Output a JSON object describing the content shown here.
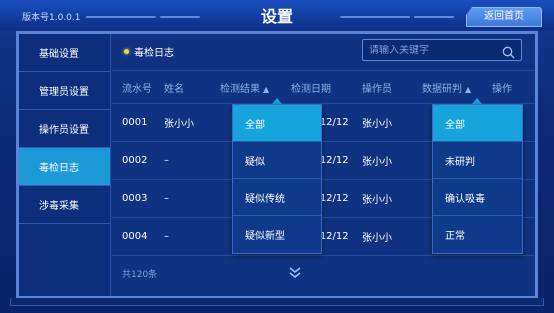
{
  "header": {
    "version": "版本号1.0.0.1",
    "title": "设置",
    "back_label": "返回首页"
  },
  "sidebar": {
    "items": [
      {
        "label": "基础设置"
      },
      {
        "label": "管理员设置"
      },
      {
        "label": "操作员设置"
      },
      {
        "label": "毒检日志",
        "active": true
      },
      {
        "label": "涉毒采集"
      }
    ]
  },
  "main": {
    "breadcrumb": "毒检日志",
    "search_placeholder": "请输入关键字",
    "columns": [
      "流水号",
      "姓名",
      "检测结果",
      "检测日期",
      "操作员",
      "数据研判",
      "操作"
    ],
    "rows": [
      {
        "serial": "0001",
        "name": "张小小",
        "date": "2022/12/12",
        "operator": "张小小"
      },
      {
        "serial": "0002",
        "name": "–",
        "date": "2022/12/12",
        "operator": "张小小"
      },
      {
        "serial": "0003",
        "name": "–",
        "date": "2022/12/12",
        "operator": "张小小"
      },
      {
        "serial": "0004",
        "name": "–",
        "date": "2022/12/12",
        "operator": "张小小"
      }
    ],
    "total": "共120条"
  },
  "dropdown_result": {
    "options": [
      "全部",
      "疑似",
      "疑似传统",
      "疑似新型"
    ],
    "selected": "全部"
  },
  "dropdown_judge": {
    "options": [
      "全部",
      "未研判",
      "确认吸毒",
      "正常"
    ],
    "selected": "全部"
  },
  "colors": {
    "accent": "#17a4dd",
    "background": "#0c2a76",
    "dot": "#f5d445"
  }
}
